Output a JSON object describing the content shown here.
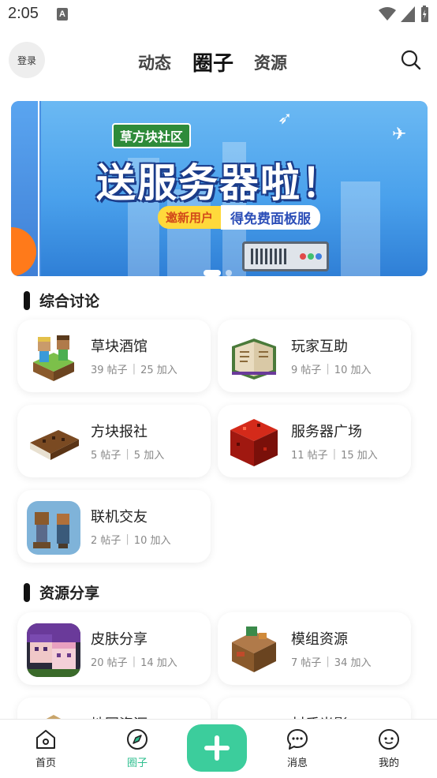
{
  "status_bar": {
    "time": "2:05",
    "notification_badge": "A"
  },
  "header": {
    "login_label": "登录",
    "tabs": [
      {
        "label": "动态",
        "active": false
      },
      {
        "label": "圈子",
        "active": true
      },
      {
        "label": "资源",
        "active": false
      }
    ]
  },
  "banner": {
    "brand": "草方块社区",
    "title": "送服务器啦！",
    "pill_left": "邀新用户",
    "pill_right": "得免费面板服",
    "page_count": 2,
    "active_page": 1
  },
  "sections": [
    {
      "title": "综合讨论",
      "cards": [
        {
          "title": "草块酒馆",
          "posts": "39 帖子",
          "joins": "25 加入",
          "icon": "grass-block-characters-icon"
        },
        {
          "title": "玩家互助",
          "posts": "9 帖子",
          "joins": "10 加入",
          "icon": "book-icon"
        },
        {
          "title": "方块报社",
          "posts": "5 帖子",
          "joins": "5 加入",
          "icon": "leather-book-icon"
        },
        {
          "title": "服务器广场",
          "posts": "11 帖子",
          "joins": "15 加入",
          "icon": "redstone-block-icon"
        },
        {
          "title": "联机交友",
          "posts": "2 帖子",
          "joins": "10 加入",
          "icon": "pixel-friends-icon"
        }
      ]
    },
    {
      "title": "资源分享",
      "cards": [
        {
          "title": "皮肤分享",
          "posts": "20 帖子",
          "joins": "14 加入",
          "icon": "skin-characters-icon"
        },
        {
          "title": "模组资源",
          "posts": "7 帖子",
          "joins": "34 加入",
          "icon": "mod-blocks-icon"
        },
        {
          "title": "地图资源",
          "icon": "map-icon"
        },
        {
          "title": "材质光影",
          "icon": "texture-icon"
        }
      ]
    }
  ],
  "bottom_nav": [
    {
      "label": "首页",
      "icon": "home-icon",
      "active": false
    },
    {
      "label": "圈子",
      "icon": "compass-icon",
      "active": true
    },
    {
      "label": "消息",
      "icon": "message-icon",
      "active": false
    },
    {
      "label": "我的",
      "icon": "profile-icon",
      "active": false
    }
  ],
  "colors": {
    "accent": "#3ccd9c",
    "active_text": "#2fbf8f"
  }
}
